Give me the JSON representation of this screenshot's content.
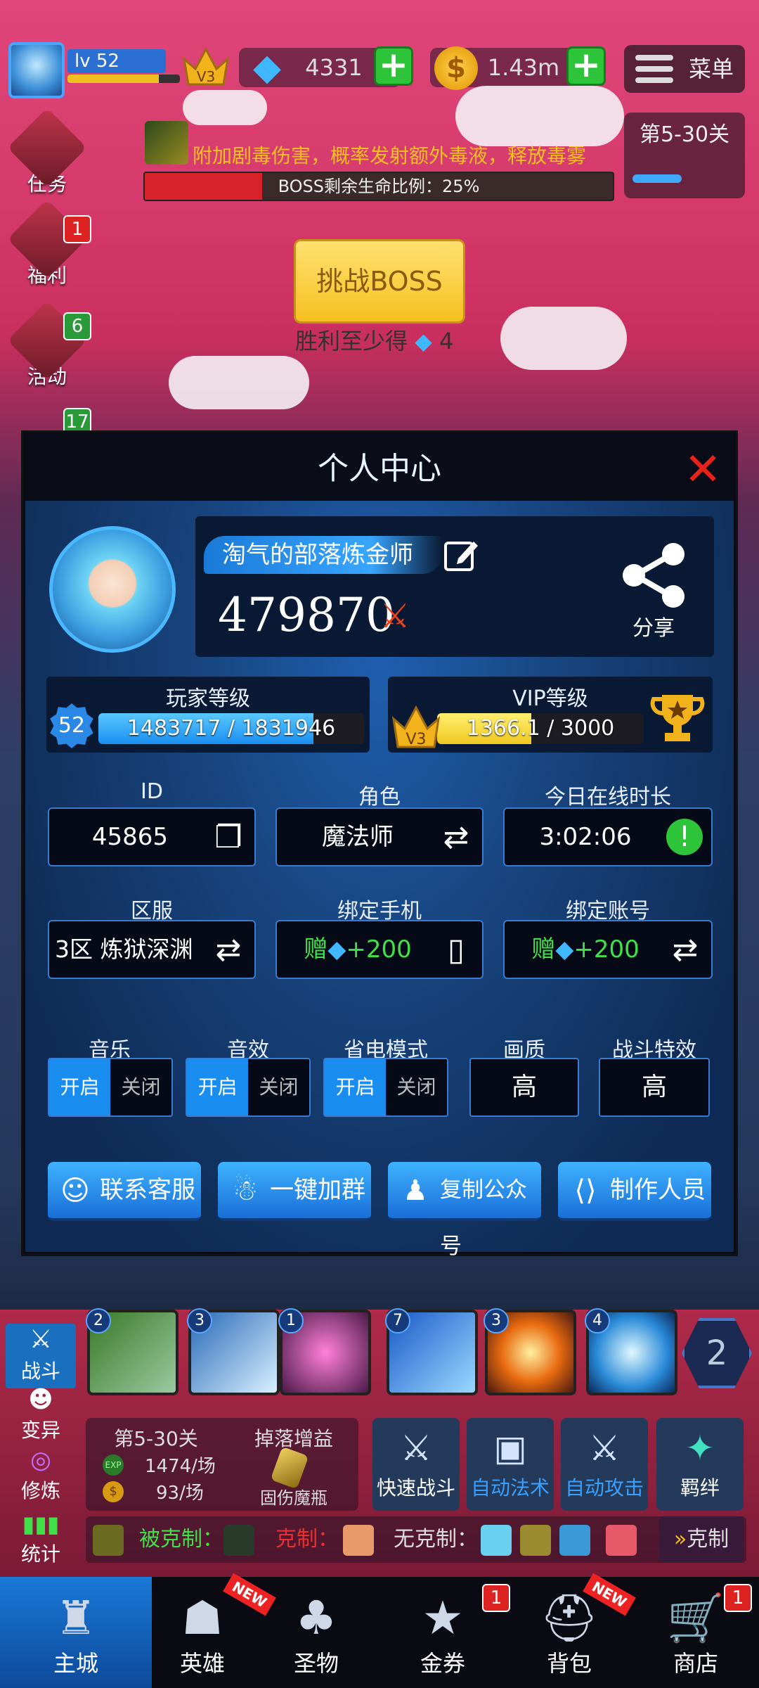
{
  "hud": {
    "level_text": "lv 52",
    "level_progress": 0.81,
    "vip_text": "V3",
    "gems": "4331",
    "coins": "1.43m",
    "menu_label": "菜单",
    "stage_label": "第5-30关",
    "skill_msg": "附加剧毒伤害，概率发射额外毒液，释放毒雾",
    "boss_hp_text": "BOSS剩余生命比例：25%",
    "boss_hp_fraction": 0.25,
    "challenge_label": "挑战BOSS",
    "victory_tip": "胜利至少得",
    "victory_gems": "4"
  },
  "side_menu": [
    {
      "label": "任务",
      "badge": ""
    },
    {
      "label": "福利",
      "badge": "1"
    },
    {
      "label": "活动",
      "badge": "6"
    },
    {
      "label": "",
      "badge": "17"
    }
  ],
  "profile": {
    "title": "个人中心",
    "close_glyph": "✕",
    "nickname": "淘气的部落炼金师",
    "power": "479870",
    "share_label": "分享",
    "player_level_title": "玩家等级",
    "player_level": "52",
    "player_exp_text": "1483717 / 1831946",
    "player_exp_fraction": 0.81,
    "vip_title": "VIP等级",
    "vip_badge": "V3",
    "vip_exp_text": "1366.1 / 3000",
    "vip_exp_fraction": 0.455,
    "fields": {
      "id_label": "ID",
      "id_value": "45865",
      "role_label": "角色",
      "role_value": "魔法师",
      "online_label": "今日在线时长",
      "online_value": "3:02:06",
      "server_label": "区服",
      "server_value": "3区 炼狱深渊",
      "phone_label": "绑定手机",
      "phone_value_prefix": "赠",
      "phone_value_suffix": "+200",
      "account_label": "绑定账号",
      "account_value_prefix": "赠",
      "account_value_suffix": "+200"
    },
    "settings": {
      "music_label": "音乐",
      "sfx_label": "音效",
      "power_label": "省电模式",
      "quality_label": "画质",
      "effect_label": "战斗特效",
      "on_text": "开启",
      "off_text": "关闭",
      "quality_value": "高",
      "effect_value": "高"
    },
    "actions": [
      "联系客服",
      "一键加群",
      "复制公众号",
      "制作人员"
    ]
  },
  "battle": {
    "side_tabs": [
      "战斗",
      "变异",
      "修炼",
      "统计"
    ],
    "skill_levels": [
      "2",
      "3",
      "1",
      "7",
      "3",
      "4"
    ],
    "hex_value": "2",
    "stage": "第5-30关",
    "exp_rate": "1474/场",
    "coin_rate": "93/场",
    "drop_title": "掉落增益",
    "drop_item": "固伤魔瓶",
    "quick_buttons": [
      "快速战斗",
      "自动法术",
      "自动攻击",
      "羁绊"
    ],
    "countered_label": "被克制：",
    "counter_label": "克制：",
    "neutral_label": "无克制：",
    "counter_btn": "克制"
  },
  "nav": [
    {
      "label": "主城",
      "badge": "",
      "new": false
    },
    {
      "label": "英雄",
      "badge": "",
      "new": true
    },
    {
      "label": "圣物",
      "badge": "",
      "new": false
    },
    {
      "label": "金券",
      "badge": "1",
      "new": false
    },
    {
      "label": "背包",
      "badge": "",
      "new": true
    },
    {
      "label": "商店",
      "badge": "1",
      "new": false
    }
  ],
  "colors": {
    "accent_blue": "#1a8ef0",
    "green_text": "#3fe04a",
    "close_red": "#e8221a",
    "gold": "#f0c020"
  }
}
